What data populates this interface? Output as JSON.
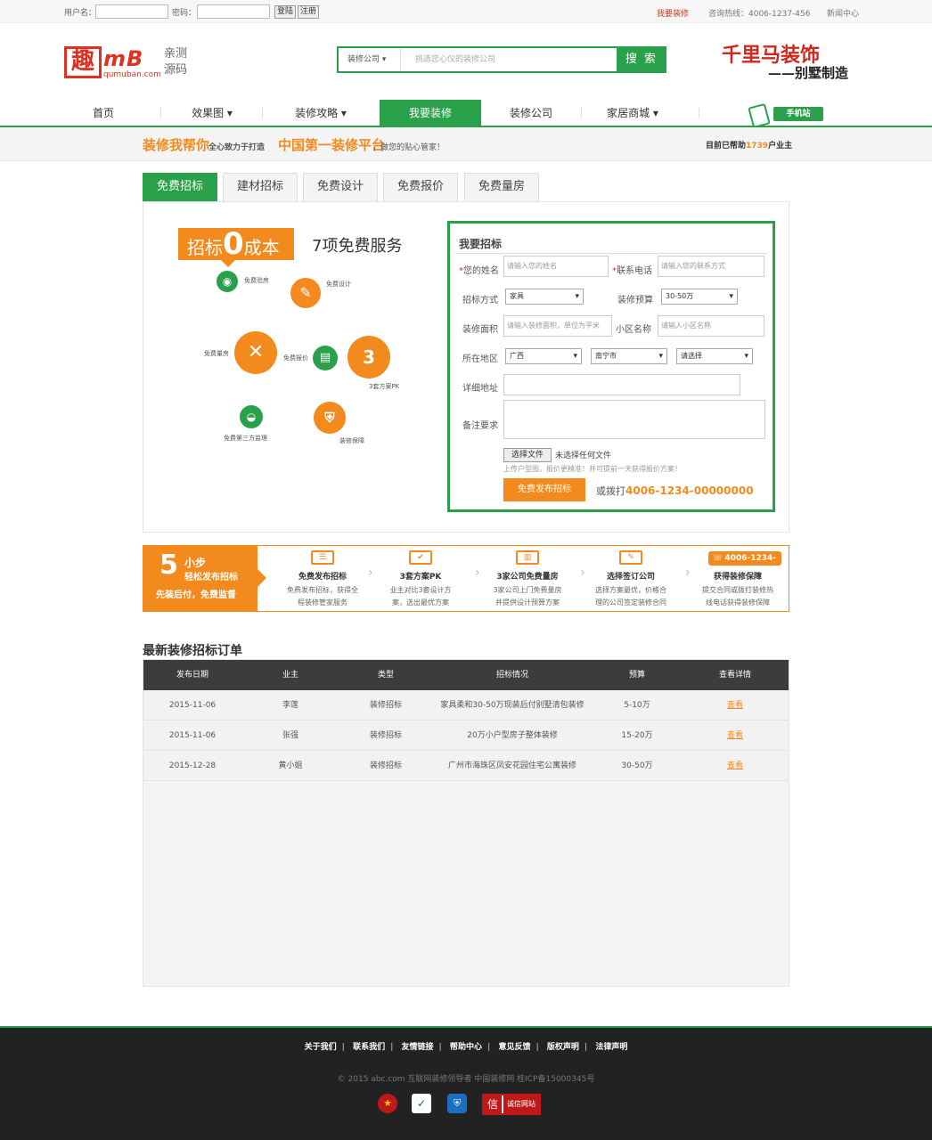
{
  "topbar": {
    "username_label": "用户名：",
    "password_label": "密码：",
    "login": "登陆",
    "register": "注册",
    "right_links": [
      "我要装修",
      "咨询热线：4006-1237-456",
      "新闻中心"
    ]
  },
  "header": {
    "logo_char": "趣",
    "logo_mb": "mB",
    "logo_domain": "qumuban.com",
    "slogan": "亲测源码",
    "search_select": "装修公司",
    "search_placeholder": "挑选您心仪的装修公司",
    "search_button": "搜 索",
    "brand_title": "千里马装饰",
    "brand_sub": "——别墅制造"
  },
  "nav": {
    "items": [
      "首页",
      "效果图",
      "装修攻略",
      "我要装修",
      "装修公司",
      "家居商城"
    ],
    "mobile_label": "手机站"
  },
  "banner": {
    "part1": "装修我帮你",
    "part2": "全心致力于打造",
    "part3": "中国第一装修平台",
    "part4": "，做您的贴心管家！",
    "right_prefix": "目前已帮助",
    "right_count": "1739",
    "right_suffix": "户业主"
  },
  "tabs": [
    "免费招标",
    "建材招标",
    "免费设计",
    "免费报价",
    "免费量房"
  ],
  "promo": {
    "zero_prefix": "招标",
    "zero_big": "0",
    "zero_suffix": "成本",
    "seven": "7项免费服务",
    "services": [
      "免费验房",
      "免费设计",
      "免费量房",
      "免费报价",
      "3套方案PK",
      "免费第三方监理",
      "装修保障"
    ]
  },
  "form": {
    "title": "我要招标",
    "name_label": "您的姓名",
    "name_placeholder": "请输入您的姓名",
    "phone_label": "联系电话",
    "phone_placeholder": "请输入您的联系方式",
    "method_label": "招标方式",
    "method_value": "家具",
    "budget_label": "装修预算",
    "budget_value": "30-50万",
    "area_label": "装修面积",
    "area_placeholder": "请输入装修面积，单位为平米",
    "community_label": "小区名称",
    "community_placeholder": "请输入小区名称",
    "region_label": "所在地区",
    "province": "广西",
    "city": "南宁市",
    "district": "请选择",
    "address_label": "详细地址",
    "note_label": "备注要求",
    "file_button": "选择文件",
    "file_status": "未选择任何文件",
    "hint": "上传户型图，报价更精准！并可提前一天获得报价方案！",
    "submit": "免费发布招标",
    "or_call": "或拨打",
    "phone_number": "4006-1234-00000000"
  },
  "steps": {
    "num": "5",
    "small": "小步",
    "easy": "轻松发布招标",
    "tagline": "先装后付，免费监督",
    "phone_tag": "4006-1234-",
    "items": [
      {
        "title": "免费发布招标",
        "l1": "免费发布招标，获得全",
        "l2": "程装修管家服务"
      },
      {
        "title": "3套方案PK",
        "l1": "业主对比3套设计方",
        "l2": "案，选出最优方案"
      },
      {
        "title": "3家公司免费量房",
        "l1": "3家公司上门免费量房",
        "l2": "并提供设计预算方案"
      },
      {
        "title": "选择签订公司",
        "l1": "选择方案最优，价格合",
        "l2": "理的公司签定装修合同"
      },
      {
        "title": "获得装修保障",
        "l1": "提交合同或拨打装修热",
        "l2": "线电话获得装修保障"
      }
    ]
  },
  "orders": {
    "title": "最新装修招标订单",
    "headers": [
      "发布日期",
      "业主",
      "类型",
      "招标情况",
      "预算",
      "查看详情"
    ],
    "rows": [
      [
        "2015-11-06",
        "李莲",
        "装修招标",
        "家具柔和30-50万现装后付别墅清包装修",
        "5-10万",
        "查看"
      ],
      [
        "2015-11-06",
        "张强",
        "装修招标",
        "20万小户型房子整体装修",
        "15-20万",
        "查看"
      ],
      [
        "2015-12-28",
        "黄小姐",
        "装修招标",
        "广州市海珠区凤安花园住宅公寓装修",
        "30-50万",
        "查看"
      ]
    ]
  },
  "footer": {
    "links": [
      "关于我们",
      "联系我们",
      "友情链接",
      "帮助中心",
      "意见反馈",
      "版权声明",
      "法律声明"
    ],
    "copyright": "© 2015 abc.com 互联网装修领导者 中国装修网 桂ICP备15000345号",
    "credit_badge": "诚信网站",
    "credit_char": "信"
  },
  "colors": {
    "green": "#2aa04a",
    "orange": "#f28a1e",
    "red": "#d0281c"
  }
}
